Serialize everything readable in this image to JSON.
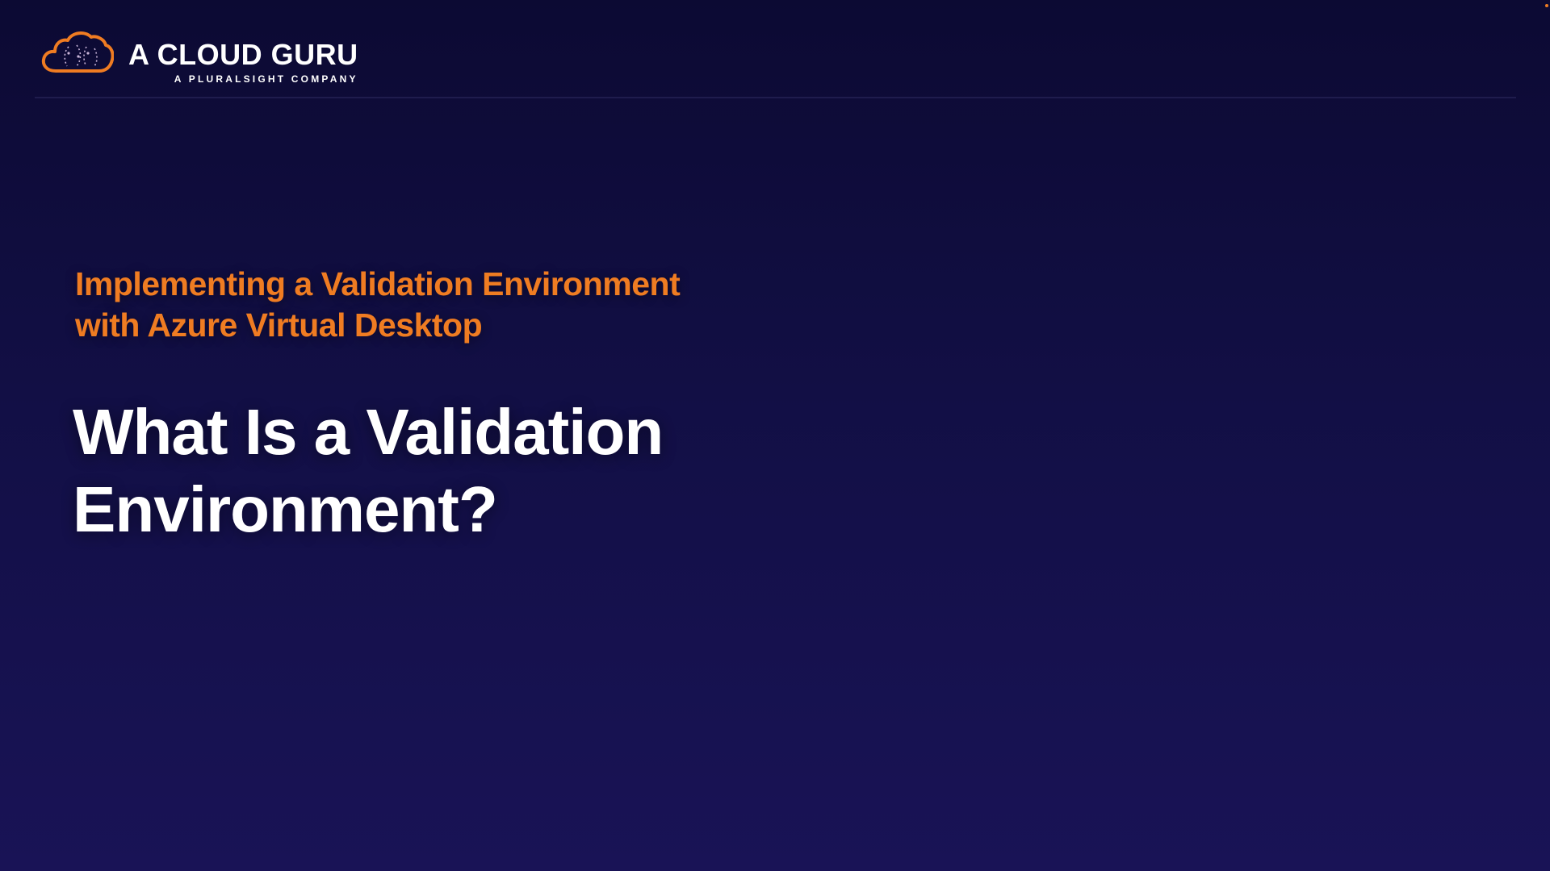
{
  "header": {
    "brand": "A CLOUD GURU",
    "tagline": "A PLURALSIGHT COMPANY",
    "logo_icon": "cloud-logo-icon",
    "accent_color": "#ef7c22"
  },
  "slide": {
    "course_title_line1": "Implementing a Validation Environment",
    "course_title_line2": "with Azure Virtual Desktop",
    "lesson_title_line1": "What Is a Validation",
    "lesson_title_line2": "Environment?"
  }
}
